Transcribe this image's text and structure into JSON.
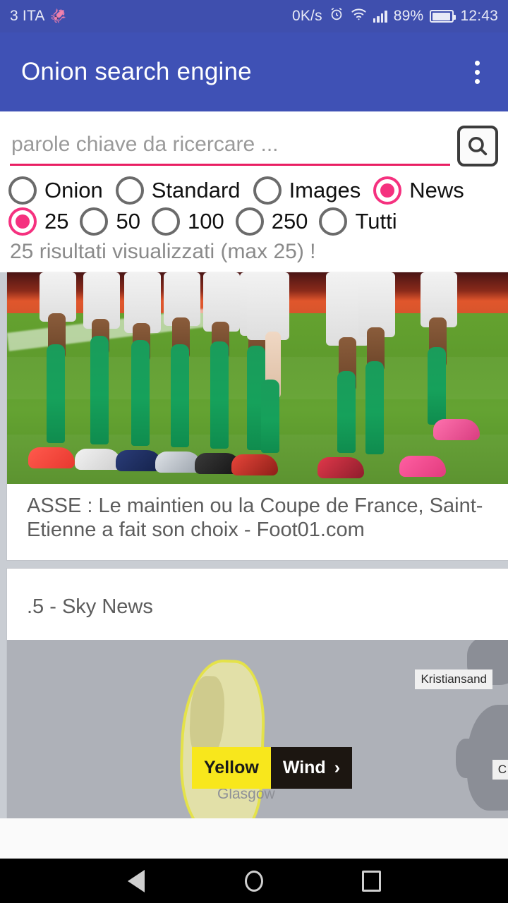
{
  "status_bar": {
    "carrier": "3 ITA",
    "carrier_icon": "octopus-icon",
    "net_speed": "0K/s",
    "alarm_icon": "alarm-icon",
    "wifi_icon": "wifi-icon",
    "signal_icon": "signal-bars-icon",
    "battery_percent": "89%",
    "battery_icon": "battery-icon",
    "clock": "12:43",
    "background_color": "#3F4FAE"
  },
  "app_bar": {
    "title": "Onion search engine",
    "overflow_icon": "more-vertical-icon",
    "background_color": "#3F51B5"
  },
  "search": {
    "placeholder": "parole chiave da ricercare ...",
    "value": "",
    "underline_color": "#E91E63",
    "button_icon": "search-icon"
  },
  "engine_options": {
    "selected": "News",
    "items": [
      {
        "label": "Onion",
        "selected": false
      },
      {
        "label": "Standard",
        "selected": false
      },
      {
        "label": "Images",
        "selected": false
      },
      {
        "label": "News",
        "selected": true
      }
    ]
  },
  "count_options": {
    "selected": "25",
    "items": [
      {
        "label": "25",
        "selected": true
      },
      {
        "label": "50",
        "selected": false
      },
      {
        "label": "100",
        "selected": false
      },
      {
        "label": "250",
        "selected": false
      },
      {
        "label": "Tutti",
        "selected": false
      }
    ]
  },
  "results_summary": "25 risultati visualizzati (max 25) !",
  "accent_color": "#F5317F",
  "results": [
    {
      "type": "photo-card",
      "image_alt": "soccer-players-legs-green-socks-on-pitch",
      "caption": "ASSE : Le maintien ou la Coupe de France, Saint-Etienne a fait son choix - Foot01.com"
    },
    {
      "type": "map-card",
      "title": ".5 - Sky News",
      "image_alt": "weather-warning-map",
      "map": {
        "warning_level": "Yellow",
        "warning_type": "Wind",
        "warning_chevron": "›",
        "labels": [
          {
            "text": "Kristiansand",
            "kind": "boxed"
          },
          {
            "text": "C",
            "kind": "boxed-clipped"
          }
        ],
        "cities": [
          "Glasgow"
        ]
      }
    }
  ],
  "nav_bar": {
    "back_icon": "back-triangle-icon",
    "home_icon": "home-circle-icon",
    "recents_icon": "recents-square-icon"
  }
}
